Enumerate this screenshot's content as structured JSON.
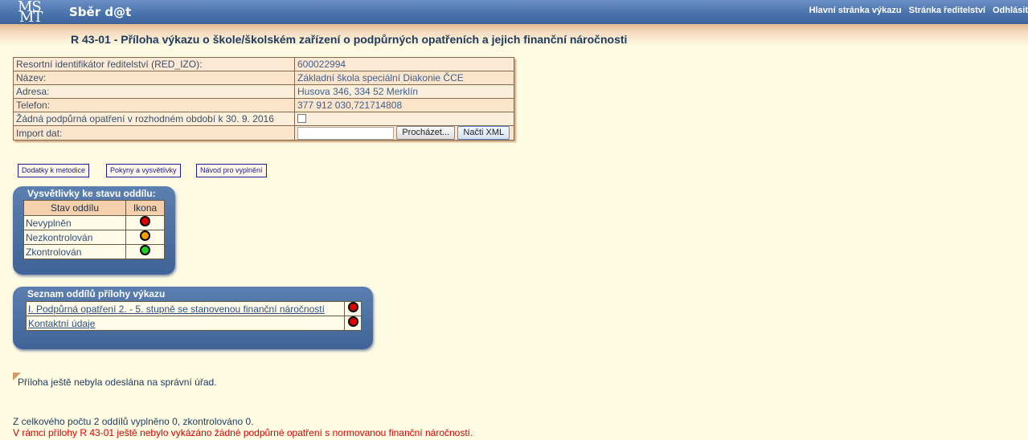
{
  "header": {
    "logo_top": "MŠ",
    "logo_bottom": "MT",
    "app_title": "Sběr d@t",
    "nav": [
      "Hlavní stránka výkazu",
      "Stránka ředitelství",
      "Odhlásit"
    ]
  },
  "page_title": "R 43-01 - Příloha výkazu o škole/školském zařízení o podpůrných opatřeních a jejich finanční náročnosti",
  "info": {
    "red_izo_label": "Resortní identifikátor ředitelství (RED_IZO):",
    "red_izo_value": "600022994",
    "name_label": "Název:",
    "name_value": "Základní škola speciální Diakonie ČCE",
    "address_label": "Adresa:",
    "address_value": "Husova 346, 334 52 Merklín",
    "phone_label": "Telefon:",
    "phone_value": "377 912 030,721714808",
    "no_measures_label": "Žádná podpůrná opatření v rozhodném období k 30. 9. 2016",
    "import_label": "Import dat:",
    "browse_button": "Procházet...",
    "load_xml_button": "Načti XML"
  },
  "links": {
    "addenda": "Dodatky k metodice",
    "instructions": "Pokyny a vysvětlivky",
    "guide": "Návod pro vyplnění"
  },
  "legend": {
    "title": "Vysvětlivky ke stavu oddílu:",
    "col_state": "Stav oddílu",
    "col_icon": "Ikona",
    "rows": [
      {
        "label": "Nevyplněn",
        "color": "#e00000"
      },
      {
        "label": "Nezkontrolován",
        "color": "#f0a000"
      },
      {
        "label": "Zkontrolován",
        "color": "#22cc22"
      }
    ]
  },
  "sections": {
    "title": "Seznam oddílů přílohy výkazu",
    "items": [
      {
        "label": "I. Podpůrná opatření 2. - 5. stupně se stanovenou finanční náročností",
        "color": "#e00000"
      },
      {
        "label": "Kontaktní údaje",
        "color": "#e00000"
      }
    ]
  },
  "notes": {
    "not_sent": "Příloha ještě nebyla odeslána na správní úřad.",
    "summary": "Z celkového počtu 2 oddílů vyplněno 0, zkontrolováno 0.",
    "warning": "V rámci přílohy R 43-01 ještě nebylo vykázáno žádné podpůrné opatření s normovanou finanční náročností.",
    "summary_color": "#1e3a5f",
    "warning_color": "#e00000"
  }
}
